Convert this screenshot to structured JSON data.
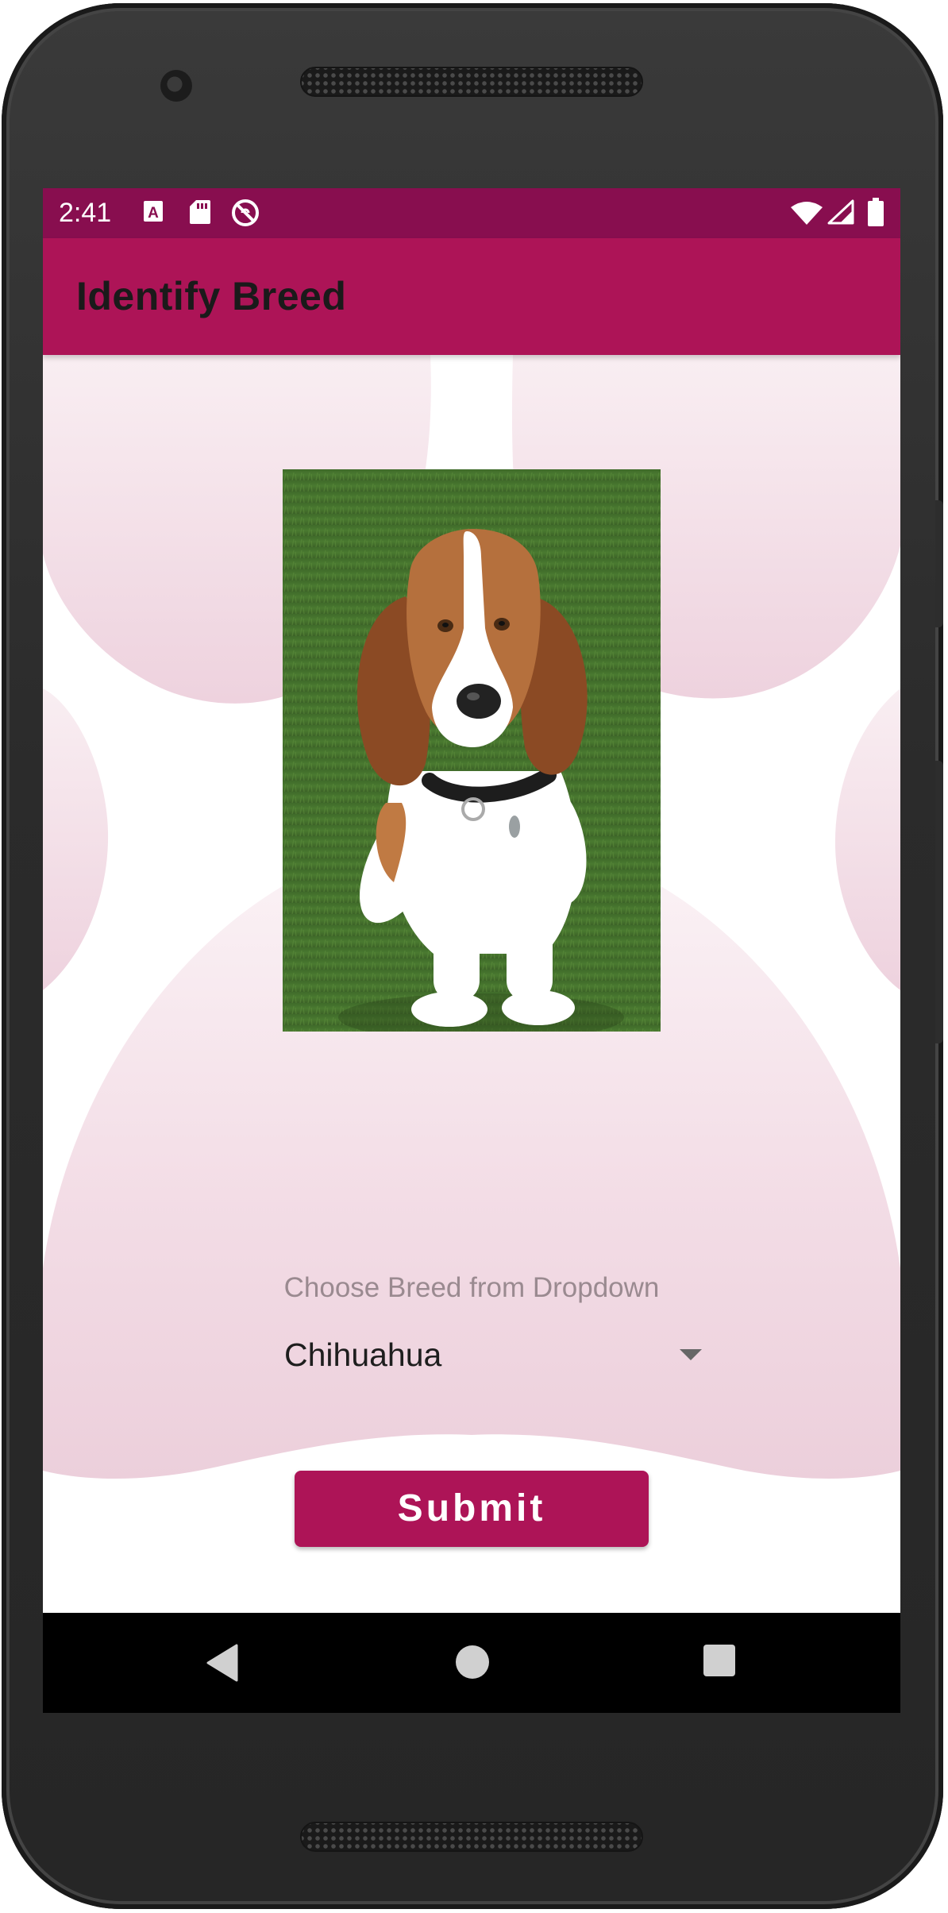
{
  "status_bar": {
    "time": "2:41",
    "left_icons": [
      "font-a-icon",
      "sd-card-icon",
      "do-not-disturb-icon"
    ],
    "right_icons": [
      "wifi-icon",
      "cell-signal-icon",
      "battery-icon"
    ]
  },
  "app_bar": {
    "title": "Identify Breed"
  },
  "main": {
    "photo": {
      "icon": "dog-photo",
      "subject": "basset hound sitting on grass"
    },
    "breed_prompt": "Choose Breed from Dropdown",
    "breed_dropdown": {
      "selected": "Chihuahua",
      "icon": "dropdown-caret-icon"
    },
    "submit_label": "Submit"
  },
  "nav_bar": {
    "icons": [
      "back-icon",
      "home-icon",
      "recents-icon"
    ]
  },
  "colors": {
    "status_bar": "#880e4f",
    "app_bar": "#ad1457",
    "accent": "#ad1457",
    "paw_background": "#f3dbe4"
  }
}
